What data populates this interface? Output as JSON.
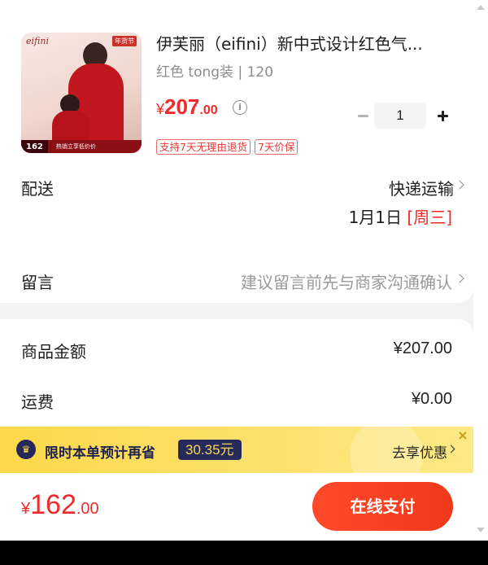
{
  "product": {
    "image_brand": "eifini",
    "image_tag": "年货节",
    "image_price": "162",
    "image_caption": "热销立享低价价",
    "title": "伊芙丽（eifini）新中式设计红色气...",
    "spec": "红色 tong装 | 120",
    "price_symbol": "¥",
    "price_int": "207",
    "price_dec": ".00",
    "quantity": "1",
    "badges": [
      "支持7天无理由退货",
      "7天价保"
    ]
  },
  "delivery": {
    "label": "配送",
    "method": "快递运输",
    "date": "1月1日",
    "weekday": "[周三]"
  },
  "note": {
    "label": "留言",
    "placeholder": "建议留言前先与商家沟通确认"
  },
  "summary": {
    "goods_label": "商品金额",
    "goods_value": "¥207.00",
    "shipping_label": "运费",
    "shipping_value": "¥0.00"
  },
  "promo": {
    "text": "限时本单预计再省",
    "amount": "30.35元",
    "cta": "去享优惠"
  },
  "footer": {
    "total_symbol": "¥",
    "total_int": "162",
    "total_dec": ".00",
    "pay_label": "在线支付"
  },
  "colors": {
    "accent": "#ee2a2a",
    "pay_button": "#f0381b",
    "promo_bg": "#fcd94a",
    "promo_dark": "#252a5b"
  }
}
